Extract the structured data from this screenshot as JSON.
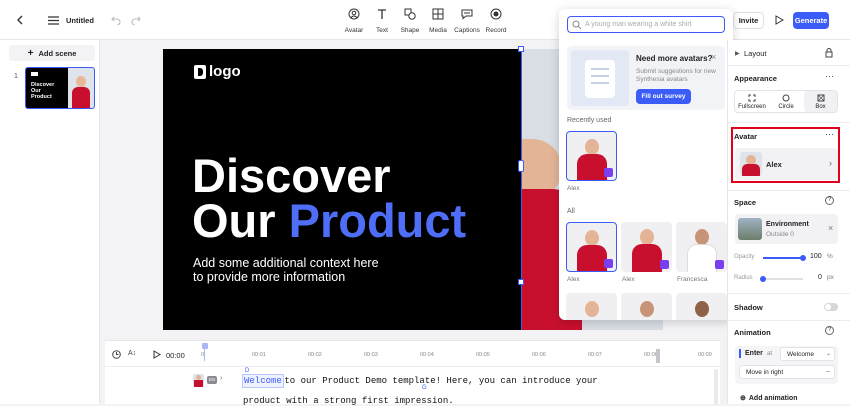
{
  "header": {
    "title": "Untitled",
    "tools": [
      {
        "label": "Avatar"
      },
      {
        "label": "Text"
      },
      {
        "label": "Shape"
      },
      {
        "label": "Media"
      },
      {
        "label": "Captions"
      },
      {
        "label": "Record"
      }
    ],
    "invite_label": "Invite",
    "generate_label": "Generate"
  },
  "left": {
    "add_scene_label": "Add scene",
    "scene_number": "1",
    "thumb_text": "Discover Our Product"
  },
  "slide": {
    "logo_text": "logo",
    "heading_line1": "Discover",
    "heading_line2_white": "Our",
    "heading_line2_blue": "Product",
    "subtext_line1": "Add some additional context here",
    "subtext_line2": "to provide more information"
  },
  "popup": {
    "search_placeholder": "A young man wearing a white shirt",
    "promo_title": "Need more avatars?",
    "promo_text": "Submit suggestions for new Synthesia avatars",
    "promo_button": "Fill out survey",
    "recently_used_label": "Recently used",
    "recent_name": "Alex",
    "all_label": "All",
    "all_names": [
      "Alex",
      "Alex",
      "Francesca"
    ]
  },
  "right": {
    "layout_label": "Layout",
    "appearance_label": "Appearance",
    "appearance_options": [
      "Fullscreen",
      "Circle",
      "Box"
    ],
    "avatar_label": "Avatar",
    "avatar_name": "Alex",
    "space_label": "Space",
    "env_title": "Environment",
    "env_sub": "Outside 0",
    "opacity_label": "Opacity",
    "opacity_value": "100",
    "opacity_unit": "%",
    "opacity_level": 1.0,
    "radius_label": "Radius",
    "radius_value": "0",
    "radius_unit": "px",
    "shadow_label": "Shadow",
    "animation_label": "Animation",
    "enter_label": "Enter",
    "at_label": "at",
    "enter_value": "Welcome",
    "move_value": "Move in right",
    "add_animation_label": "Add animation"
  },
  "timeline": {
    "time": "00:00",
    "ticks": [
      "0",
      "00:01",
      "00:02",
      "00:03",
      "00:04",
      "00:05",
      "00:06",
      "00:07",
      "00:08",
      "00:09"
    ],
    "lang_badge": "EN",
    "script_first_word": "Welcome",
    "script_rest_line1": " to our Product Demo template! Here, you can introduce your",
    "script_line2": "product with a strong first impression."
  },
  "colors": {
    "accent": "#3b5cf6",
    "avatar_red": "#c8102e",
    "badge_purple": "#7b3ff2",
    "highlight_border": "#e0001b"
  }
}
